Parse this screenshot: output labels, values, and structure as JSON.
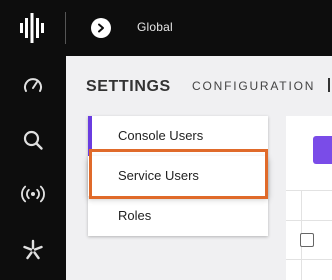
{
  "header": {
    "scope_label": "Global",
    "logo_icon": "brand-logo-icon",
    "nav_icon": "chevron-right-icon"
  },
  "leftnav": {
    "items": [
      {
        "icon": "gauge-icon"
      },
      {
        "icon": "search-icon"
      },
      {
        "icon": "broadcast-icon"
      },
      {
        "icon": "asterisk-icon"
      }
    ]
  },
  "page": {
    "title": "SETTINGS",
    "tabs": [
      {
        "label": "CONFIGURATION"
      }
    ]
  },
  "settings_menu": {
    "items": [
      {
        "label": "Console Users",
        "active": true
      },
      {
        "label": "Service Users",
        "highlighted": true
      },
      {
        "label": "Roles"
      }
    ]
  },
  "colors": {
    "accent": "#6a3ce0",
    "highlight": "#e06a2a",
    "topbar": "#0d0d0d"
  }
}
